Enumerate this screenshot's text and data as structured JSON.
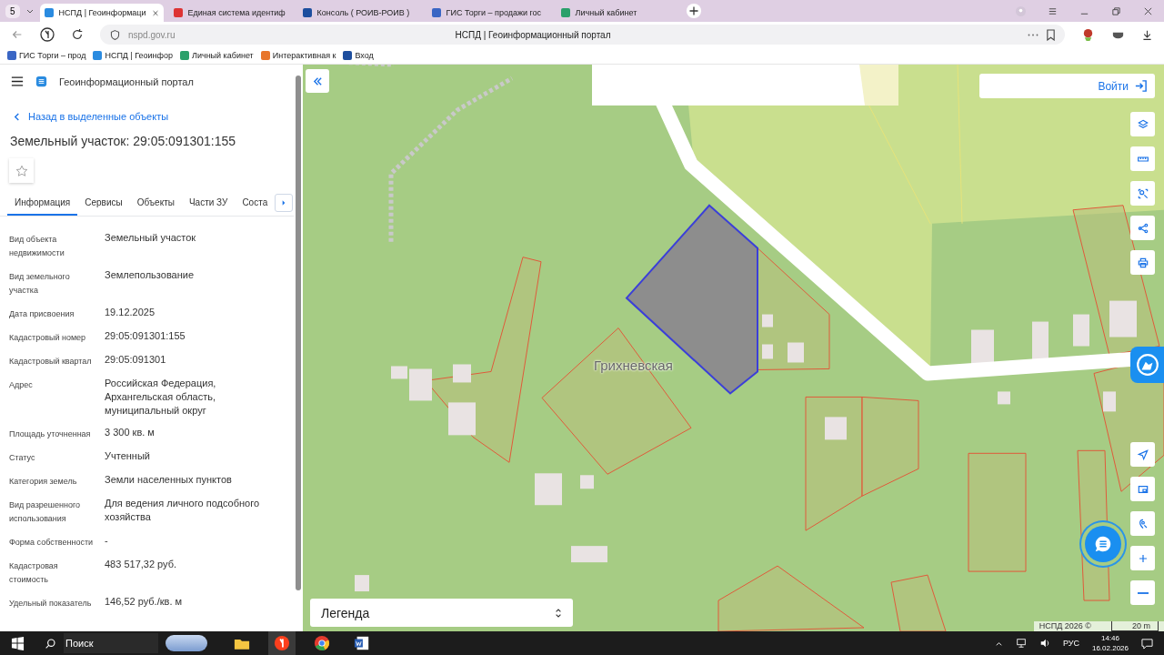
{
  "browser": {
    "tab_count": "5",
    "tabs": [
      {
        "title": "НСПД | Геоинформаци",
        "kind": "portal",
        "selected": true
      },
      {
        "title": "Единая система идентиф",
        "kind": "flag",
        "selected": false
      },
      {
        "title": "Консоль ( РОИВ-РОИВ )",
        "kind": "diamond",
        "selected": false
      },
      {
        "title": "ГИС Торги – продажи гос",
        "kind": "emblem",
        "selected": false
      },
      {
        "title": "Личный кабинет",
        "kind": "cabinet",
        "selected": false
      }
    ],
    "address": "nspd.gov.ru",
    "page_title": "НСПД | Геоинформационный портал",
    "bookmarks": [
      {
        "label": "ГИС Торги – прод",
        "kind": "emblem"
      },
      {
        "label": "НСПД | Геоинфор",
        "kind": "portal"
      },
      {
        "label": "Личный кабинет",
        "kind": "cabinet"
      },
      {
        "label": "Интерактивная к",
        "kind": "map"
      },
      {
        "label": "Вход",
        "kind": "diamond"
      }
    ]
  },
  "panel": {
    "header": "Геоинформационный портал",
    "back": "Назад в выделенные объекты",
    "heading": "Земельный участок: 29:05:091301:155",
    "favorite": false,
    "tabs": [
      {
        "label": "Информация",
        "selected": true
      },
      {
        "label": "Сервисы",
        "selected": false
      },
      {
        "label": "Объекты",
        "selected": false
      },
      {
        "label": "Части ЗУ",
        "selected": false
      },
      {
        "label": "Соста",
        "selected": false
      }
    ],
    "properties": [
      {
        "label": "Вид объекта недвижимости",
        "value": "Земельный участок"
      },
      {
        "label": "Вид земельного участка",
        "value": "Землепользование"
      },
      {
        "label": "Дата присвоения",
        "value": "19.12.2025"
      },
      {
        "label": "Кадастровый номер",
        "value": "29:05:091301:155"
      },
      {
        "label": "Кадастровый квартал",
        "value": "29:05:091301"
      },
      {
        "label": "Адрес",
        "value": "Российская Федерация, Архангельская область, муниципальный округ"
      },
      {
        "label": "Площадь уточненная",
        "value": "3 300 кв. м"
      },
      {
        "label": "Статус",
        "value": "Учтенный"
      },
      {
        "label": "Категория земель",
        "value": "Земли населенных пунктов"
      },
      {
        "label": "Вид разрешенного использования",
        "value": "Для ведения личного подсобного хозяйства"
      },
      {
        "label": "Форма собственности",
        "value": "-"
      },
      {
        "label": "Кадастровая стоимость",
        "value": "483 517,32 руб."
      },
      {
        "label": "Удельный показатель",
        "value": "146,52 руб./кв. м"
      }
    ]
  },
  "map": {
    "place_label": "Грихневская",
    "login": "Войти",
    "legend": "Легенда",
    "attribution": "НСПД 2026 ©",
    "scale": "20 m"
  },
  "taskbar": {
    "search_placeholder": "Поиск",
    "language": "РУС",
    "time": "14:46",
    "date": "16.02.2026"
  }
}
